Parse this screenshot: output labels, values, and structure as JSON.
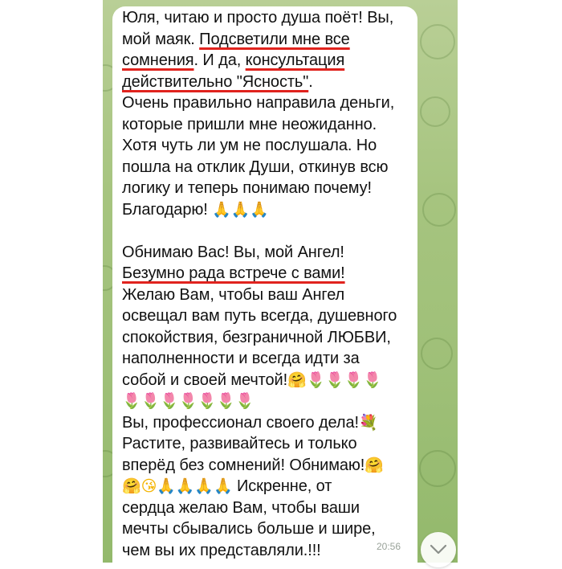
{
  "message": {
    "lines": [
      "Юля, читаю и просто душа поёт! Вы,",
      "мой маяк. ",
      "Подсветили мне все",
      "сомнения",
      ". И да, ",
      "консультация",
      "действительно \"Ясность\"",
      ".",
      "Очень правильно направила деньги,",
      "которые пришли мне неожиданно.",
      "Хотя чуть ли ум не послушала. Но",
      "пошла на отклик Души, откинув всю",
      "логику и теперь понимаю почему!",
      "Благодарю! ",
      "Обнимаю Вас! Вы, мой Ангел!",
      "Безумно рада встрече с вами!",
      "Желаю Вам, чтобы ваш Ангел",
      "освещал вам путь всегда, душевного",
      "спокойствия, безграничной ЛЮБВИ,",
      "наполненности и всегда идти за",
      "собой и своей мечтой!",
      "Вы, профессионал своего дела!",
      "Растите, развивайтесь и только",
      "вперёд без сомнений! Обнимаю!",
      " Искренне, от",
      "сердца желаю Вам, чтобы ваши",
      "мечты сбывались больше и шире,",
      "чем вы их представляли.!!!"
    ],
    "emoji": {
      "pray": "🙏",
      "tulip": "🌷",
      "hug": "🤗",
      "kiss": "😘",
      "bouquet": "💐"
    },
    "time": "20:56"
  },
  "icons": {
    "scroll_down": "chevron-down-icon"
  },
  "colors": {
    "highlight_underline": "#e0231e",
    "chat_background": "#a6c47f",
    "bubble": "#ffffff"
  }
}
